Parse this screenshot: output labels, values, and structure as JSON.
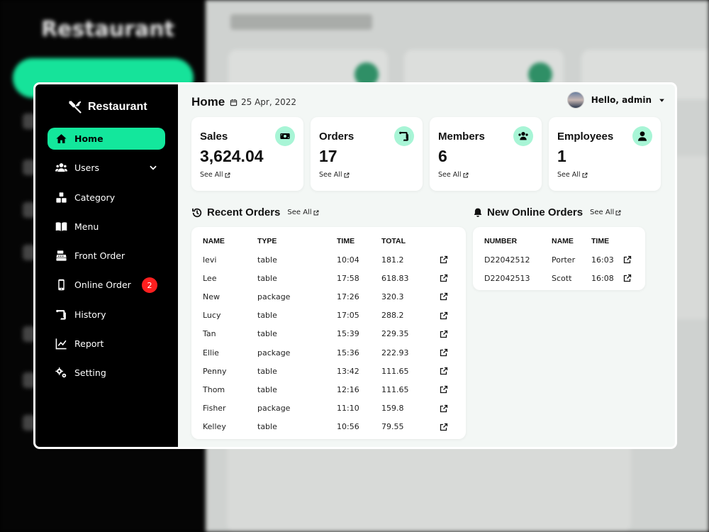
{
  "brand": {
    "name": "Restaurant"
  },
  "background": {
    "brand": "Restaurant"
  },
  "sidebar": {
    "items": [
      {
        "label": "Home",
        "icon": "home-icon"
      },
      {
        "label": "Users",
        "icon": "users-icon"
      },
      {
        "label": "Category",
        "icon": "category-icon"
      },
      {
        "label": "Menu",
        "icon": "menu-book-icon"
      },
      {
        "label": "Front Order",
        "icon": "cash-register-icon"
      },
      {
        "label": "Online Order",
        "icon": "mobile-icon",
        "badge": "2"
      },
      {
        "label": "History",
        "icon": "scroll-icon"
      },
      {
        "label": "Report",
        "icon": "chart-line-icon"
      },
      {
        "label": "Setting",
        "icon": "gears-icon"
      }
    ]
  },
  "header": {
    "title": "Home",
    "date": "25 Apr, 2022",
    "greeting": "Hello, admin"
  },
  "stats": [
    {
      "label": "Sales",
      "value": "3,624.04",
      "link": "See All",
      "icon": "money-icon"
    },
    {
      "label": "Orders",
      "value": "17",
      "link": "See All",
      "icon": "receipt-icon"
    },
    {
      "label": "Members",
      "value": "6",
      "link": "See All",
      "icon": "members-icon"
    },
    {
      "label": "Employees",
      "value": "1",
      "link": "See All",
      "icon": "employee-icon"
    }
  ],
  "recent_orders": {
    "title": "Recent Orders",
    "see_all": "See All",
    "columns": [
      "NAME",
      "TYPE",
      "TIME",
      "TOTAL"
    ],
    "rows": [
      {
        "name": "levi",
        "type": "table",
        "time": "10:04",
        "total": "181.2"
      },
      {
        "name": "Lee",
        "type": "table",
        "time": "17:58",
        "total": "618.83"
      },
      {
        "name": "New",
        "type": "package",
        "time": "17:26",
        "total": "320.3"
      },
      {
        "name": "Lucy",
        "type": "table",
        "time": "17:05",
        "total": "288.2"
      },
      {
        "name": "Tan",
        "type": "table",
        "time": "15:39",
        "total": "229.35"
      },
      {
        "name": "Ellie",
        "type": "package",
        "time": "15:36",
        "total": "222.93"
      },
      {
        "name": "Penny",
        "type": "table",
        "time": "13:42",
        "total": "111.65"
      },
      {
        "name": "Thom",
        "type": "table",
        "time": "12:16",
        "total": "111.65"
      },
      {
        "name": "Fisher",
        "type": "package",
        "time": "11:10",
        "total": "159.8"
      },
      {
        "name": "Kelley",
        "type": "table",
        "time": "10:56",
        "total": "79.55"
      }
    ]
  },
  "online_orders": {
    "title": "New Online Orders",
    "see_all": "See All",
    "columns": [
      "NUMBER",
      "NAME",
      "TIME"
    ],
    "rows": [
      {
        "number": "D22042512",
        "name": "Porter",
        "time": "16:03"
      },
      {
        "number": "D22042513",
        "name": "Scott",
        "time": "16:08"
      }
    ]
  },
  "colors": {
    "accent": "#13e79c",
    "accent_light": "#a8f5d6",
    "badge": "#ff1f1f",
    "sidebar": "#000000",
    "main_bg": "#f3f7f5"
  }
}
